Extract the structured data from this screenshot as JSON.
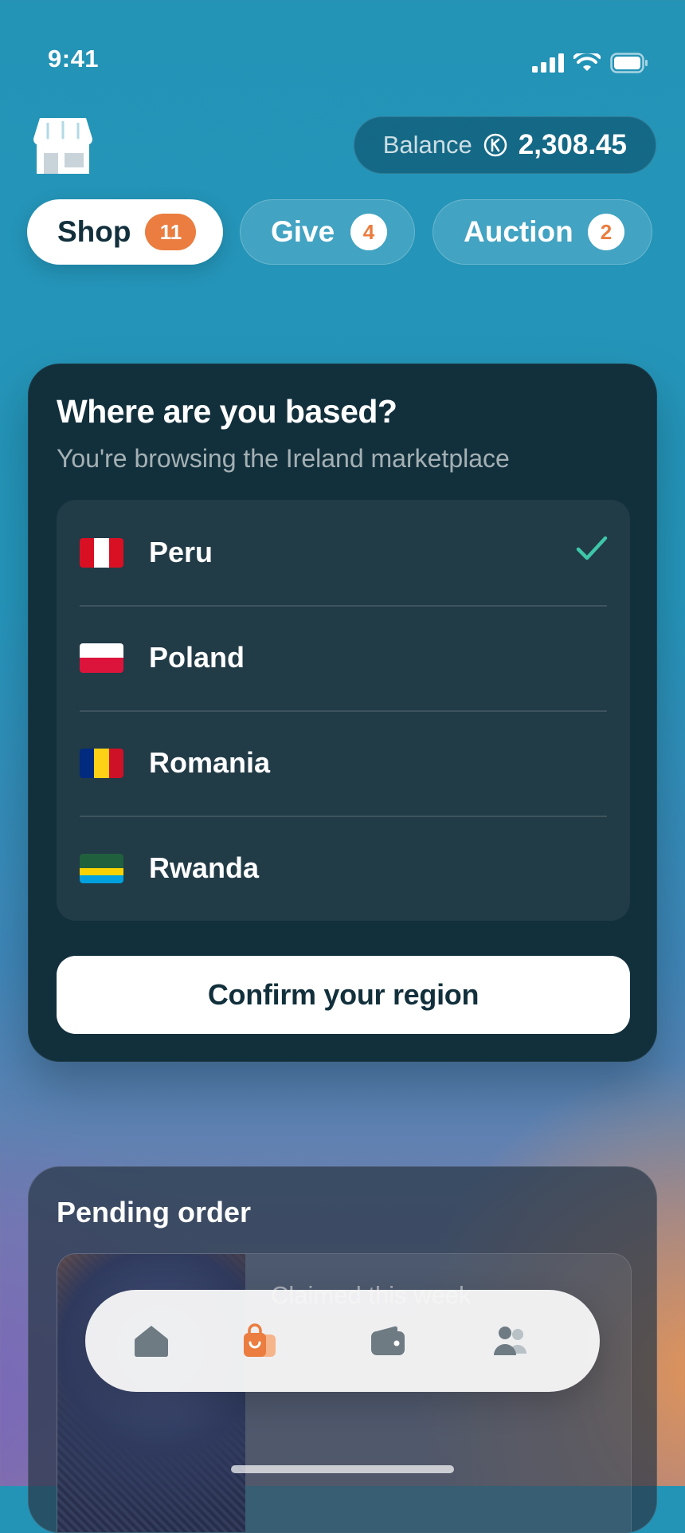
{
  "status_bar": {
    "time": "9:41"
  },
  "header": {
    "balance_label": "Balance",
    "currency_symbol": "K",
    "balance_amount": "2,308.45"
  },
  "tabs": [
    {
      "label": "Shop",
      "count": "11",
      "active": true
    },
    {
      "label": "Give",
      "count": "4",
      "active": false
    },
    {
      "label": "Auction",
      "count": "2",
      "active": false
    }
  ],
  "region_card": {
    "title": "Where are you based?",
    "subtitle": "You're browsing the Ireland marketplace",
    "countries": [
      {
        "name": "Peru",
        "selected": true,
        "flag": [
          "#d91023",
          "#ffffff",
          "#d91023"
        ]
      },
      {
        "name": "Poland",
        "selected": false,
        "flag": [
          "#ffffff",
          "#dc143c"
        ]
      },
      {
        "name": "Romania",
        "selected": false,
        "flag": [
          "#002b7f",
          "#fcd116",
          "#ce1126"
        ]
      },
      {
        "name": "Rwanda",
        "selected": false,
        "flag": [
          "#20603d",
          "#fad201",
          "#00a1de"
        ]
      }
    ],
    "confirm_label": "Confirm your region"
  },
  "pending": {
    "title": "Pending order",
    "item_text": "Claimed this week"
  },
  "nav": {
    "items": [
      {
        "icon": "home-icon",
        "active": false
      },
      {
        "icon": "shopping-bag-icon",
        "active": true
      },
      {
        "icon": "wallet-icon",
        "active": false
      },
      {
        "icon": "people-icon",
        "active": false
      }
    ]
  },
  "colors": {
    "accent": "#ea7d3f",
    "card_bg": "#12303c",
    "check": "#3dc7a8"
  }
}
